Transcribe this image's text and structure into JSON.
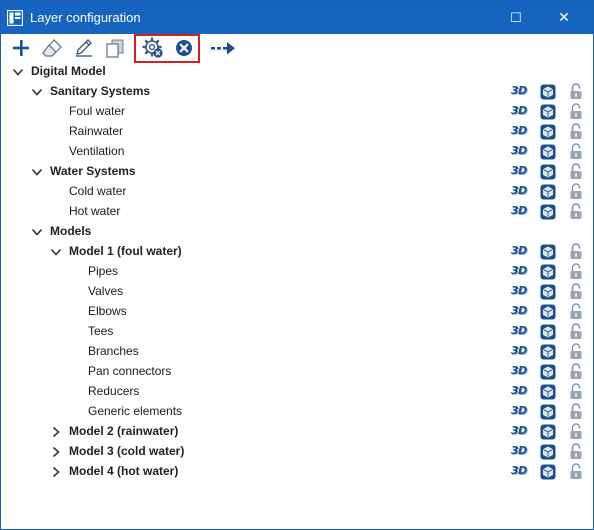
{
  "window": {
    "title": "Layer configuration",
    "maximize_glyph": "☐",
    "close_glyph": "✕"
  },
  "toolbar": {
    "buttons": [
      {
        "name": "add-icon"
      },
      {
        "name": "eraser-icon"
      },
      {
        "name": "pencil-icon"
      },
      {
        "name": "copy-icon"
      },
      {
        "name": "settings-icon"
      },
      {
        "name": "cancel-icon"
      },
      {
        "name": "arrow-right-icon"
      }
    ],
    "accent": "#1c4f8f",
    "highlight_color": "#d32028"
  },
  "tree": {
    "rows": [
      {
        "label": "Digital Model",
        "bold": true,
        "expander": "expanded",
        "level": 0,
        "icons": false
      },
      {
        "label": "Sanitary Systems",
        "bold": true,
        "expander": "expanded",
        "level": 1,
        "icons": true
      },
      {
        "label": "Foul water",
        "bold": false,
        "expander": "none",
        "level": 2,
        "icons": true
      },
      {
        "label": "Rainwater",
        "bold": false,
        "expander": "none",
        "level": 2,
        "icons": true
      },
      {
        "label": "Ventilation",
        "bold": false,
        "expander": "none",
        "level": 2,
        "icons": true
      },
      {
        "label": "Water Systems",
        "bold": true,
        "expander": "expanded",
        "level": 1,
        "icons": true
      },
      {
        "label": "Cold water",
        "bold": false,
        "expander": "none",
        "level": 2,
        "icons": true
      },
      {
        "label": "Hot water",
        "bold": false,
        "expander": "none",
        "level": 2,
        "icons": true
      },
      {
        "label": "Models",
        "bold": true,
        "expander": "expanded",
        "level": 1,
        "icons": false
      },
      {
        "label": "Model 1 (foul water)",
        "bold": true,
        "expander": "expanded",
        "level": 2,
        "icons": true
      },
      {
        "label": "Pipes",
        "bold": false,
        "expander": "none",
        "level": 3,
        "icons": true
      },
      {
        "label": "Valves",
        "bold": false,
        "expander": "none",
        "level": 3,
        "icons": true
      },
      {
        "label": "Elbows",
        "bold": false,
        "expander": "none",
        "level": 3,
        "icons": true
      },
      {
        "label": "Tees",
        "bold": false,
        "expander": "none",
        "level": 3,
        "icons": true
      },
      {
        "label": "Branches",
        "bold": false,
        "expander": "none",
        "level": 3,
        "icons": true
      },
      {
        "label": "Pan connectors",
        "bold": false,
        "expander": "none",
        "level": 3,
        "icons": true
      },
      {
        "label": "Reducers",
        "bold": false,
        "expander": "none",
        "level": 3,
        "icons": true
      },
      {
        "label": "Generic elements",
        "bold": false,
        "expander": "none",
        "level": 3,
        "icons": true
      },
      {
        "label": "Model 2 (rainwater)",
        "bold": true,
        "expander": "collapsed",
        "level": 2,
        "icons": true
      },
      {
        "label": "Model 3 (cold water)",
        "bold": true,
        "expander": "collapsed",
        "level": 2,
        "icons": true
      },
      {
        "label": "Model 4 (hot water)",
        "bold": true,
        "expander": "collapsed",
        "level": 2,
        "icons": true
      }
    ],
    "icon_3d_text": "3D"
  }
}
